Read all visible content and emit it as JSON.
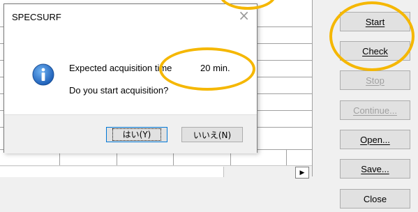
{
  "dialog": {
    "title": "SPECSURF",
    "close_glyph": "×",
    "message_line1": "Expected acquisition time",
    "time_value": "20 min.",
    "message_line2": "Do you start acquisition?",
    "yes_button": "はい(Y)",
    "no_button": "いいえ(N)",
    "icon": "info-icon"
  },
  "buttons": [
    {
      "label": "Start",
      "enabled": true
    },
    {
      "label": "Check",
      "enabled": true
    },
    {
      "label": "Stop",
      "enabled": false
    },
    {
      "label": "Continue...",
      "enabled": false
    },
    {
      "label": "Open...",
      "enabled": true
    },
    {
      "label": "Save...",
      "enabled": true
    },
    {
      "label": "Close",
      "enabled": true
    }
  ],
  "scrollbar": {
    "arrow_glyph": "▶"
  },
  "colors": {
    "highlight": "#f5b700",
    "info_icon": "#1d73c9",
    "disabled_text": "#a0a0a0"
  }
}
